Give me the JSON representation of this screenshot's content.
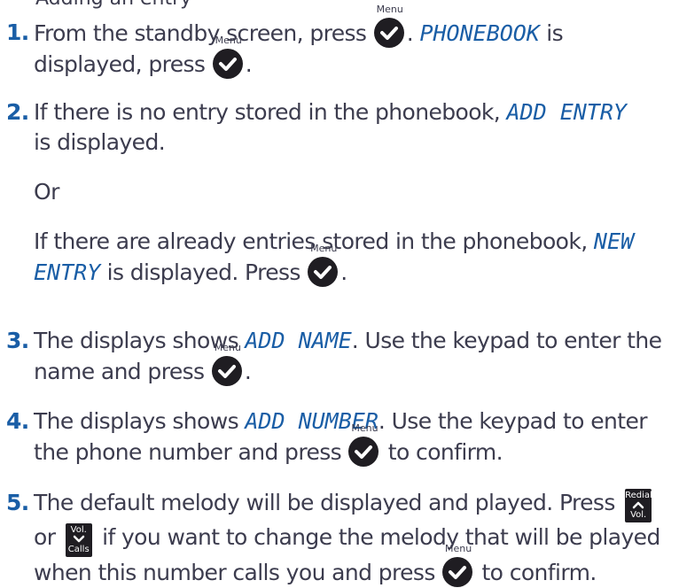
{
  "top_fragment": "Adding an entry",
  "key_labels": {
    "menu": "Menu",
    "redial": "Redial",
    "vol": "Vol.",
    "calls": "Calls"
  },
  "steps": [
    {
      "number": "1.",
      "parts": {
        "a": "From the standby screen, press",
        "b": ". ",
        "lcd1": "PHONEBOOK",
        "c": " is displayed, press",
        "d": "."
      }
    },
    {
      "number": "2.",
      "parts": {
        "a": "If there is no entry stored in the phonebook, ",
        "lcd1": "ADD ENTRY",
        "b": " is displayed.",
        "or": "Or",
        "c": "If there are already entries stored in the phonebook, ",
        "lcd2": "NEW ENTRY",
        "d": " is displayed. Press",
        "e": "."
      }
    },
    {
      "number": "3.",
      "parts": {
        "a": "The displays shows ",
        "lcd1": "ADD NAME",
        "b": ". Use the keypad to enter the name and press",
        "c": "."
      }
    },
    {
      "number": "4.",
      "parts": {
        "a": "The displays shows ",
        "lcd1": "ADD NUMBER",
        "b": ". Use the keypad to enter the phone number and press",
        "c": " to confirm."
      }
    },
    {
      "number": "5.",
      "parts": {
        "a": "The default melody will be displayed and played. Press",
        "b": "or",
        "c": "if you want to change the melody that will be played when this number calls you and press",
        "d": " to confirm."
      }
    }
  ],
  "colors": {
    "accent": "#1a5ea6",
    "text": "#3c3c4e",
    "key": "#1f1d22"
  }
}
